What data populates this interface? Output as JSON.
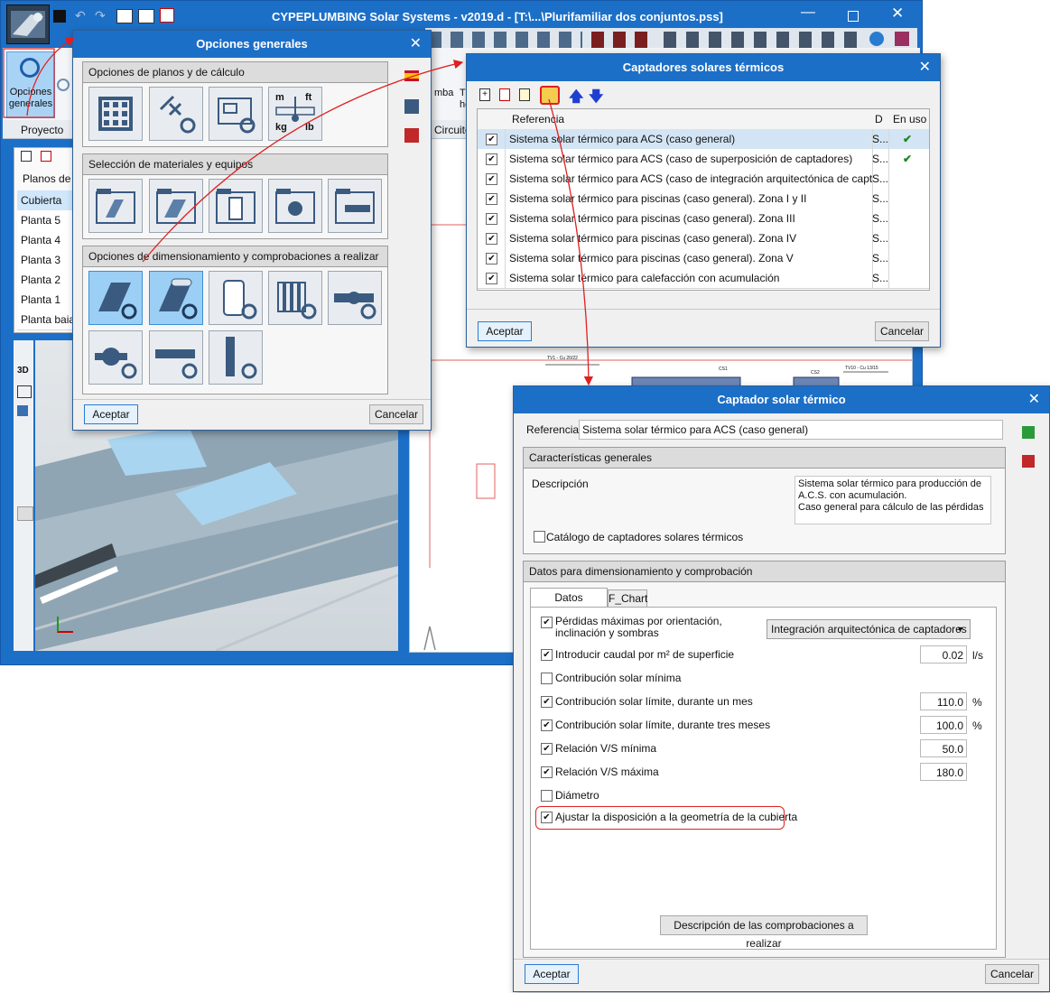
{
  "main_window": {
    "title": "CYPEPLUMBING Solar Systems - v2019.d - [T:\\...\\Plurifamiliar dos conjuntos.pss]",
    "ribbon_label": "Opciones generales",
    "tab_proyecto": "Proyecto",
    "tab_circuito": "Circuito",
    "partial_bomba": "mba",
    "partial_tho": "T\nho",
    "planos_header": "Planos de p",
    "floors": [
      "Cubierta",
      "Planta 5",
      "Planta 4",
      "Planta 3",
      "Planta 2",
      "Planta 1",
      "Planta baia"
    ],
    "label_3d": "3D",
    "plan_labels": {
      "cs1": "CS1",
      "cs2": "CS2",
      "tv1": "TV1 - Cu 20/22",
      "tv10": "TV10 - Cu 13/15"
    }
  },
  "opciones_generales": {
    "title": "Opciones generales",
    "section1": "Opciones de planos y de cálculo",
    "section2": "Selección de materiales y equipos",
    "section3": "Opciones de dimensionamiento y comprobaciones a realizar",
    "unit_labels": {
      "m": "m",
      "ft": "ft",
      "kg": "kg",
      "lb": "lb"
    },
    "accept": "Aceptar",
    "cancel": "Cancelar"
  },
  "captadores": {
    "title": "Captadores solares térmicos",
    "col_ref": "Referencia",
    "col_d": "D",
    "col_uso": "En uso",
    "rows": [
      {
        "ref": "Sistema solar térmico para ACS (caso general)",
        "d": "S...",
        "uso": "✔"
      },
      {
        "ref": "Sistema solar térmico para ACS (caso de superposición de captadores)",
        "d": "S...",
        "uso": "✔"
      },
      {
        "ref": "Sistema solar térmico para ACS (caso de integración arquitectónica de captadores)",
        "d": "S...",
        "uso": ""
      },
      {
        "ref": "Sistema solar térmico para piscinas (caso general). Zona I y II",
        "d": "S...",
        "uso": ""
      },
      {
        "ref": "Sistema solar térmico para piscinas (caso general). Zona III",
        "d": "S...",
        "uso": ""
      },
      {
        "ref": "Sistema solar térmico para piscinas (caso general). Zona IV",
        "d": "S...",
        "uso": ""
      },
      {
        "ref": "Sistema solar térmico para piscinas (caso general). Zona V",
        "d": "S...",
        "uso": ""
      },
      {
        "ref": "Sistema solar térmico para calefacción con acumulación",
        "d": "S...",
        "uso": ""
      }
    ],
    "accept": "Aceptar",
    "cancel": "Cancelar"
  },
  "captador": {
    "title": "Captador solar térmico",
    "ref_label": "Referencia",
    "ref_value": "Sistema solar térmico para ACS (caso general)",
    "sec_caract": "Características generales",
    "desc_label": "Descripción",
    "desc_value": "Sistema solar térmico para producción de A.C.S. con acumulación.\nCaso general para cálculo de las pérdidas",
    "catalog_label": "Catálogo de captadores solares térmicos",
    "sec_datos": "Datos para dimensionamiento y comprobación",
    "tab_general": "Datos generales",
    "tab_fchart": "F_Chart",
    "perdidas_label": "Pérdidas máximas por orientación, inclinación y sombras",
    "perdidas_select": "Integración arquitectónica de captadores",
    "caudal_label": "Introducir caudal por m² de superficie",
    "caudal_value": "0.02",
    "caudal_unit": "l/s",
    "contrib_min_label": "Contribución solar mínima",
    "contrib_mes_label": "Contribución solar límite, durante un mes",
    "contrib_mes_value": "110.0",
    "contrib_tres_label": "Contribución solar límite, durante tres meses",
    "contrib_tres_value": "100.0",
    "vs_min_label": "Relación V/S mínima",
    "vs_min_value": "50.0",
    "vs_max_label": "Relación V/S máxima",
    "vs_max_value": "180.0",
    "diametro_label": "Diámetro",
    "ajustar_label": "Ajustar la disposición a la geometría de la cubierta",
    "pct": "%",
    "desc_button": "Descripción de las comprobaciones a realizar",
    "accept": "Aceptar",
    "cancel": "Cancelar"
  },
  "colors": {
    "accent": "#1c6fc7",
    "highlight": "#e02020",
    "check": "#1a8a1a"
  }
}
